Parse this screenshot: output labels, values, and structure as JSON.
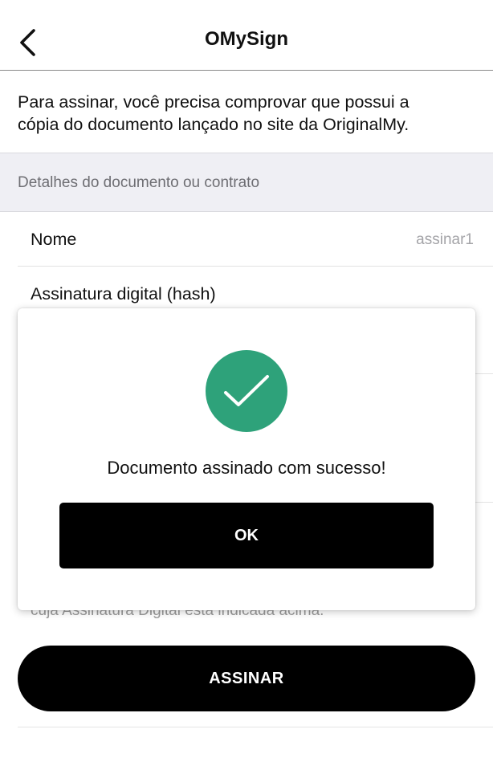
{
  "header": {
    "title": "OMySign",
    "back_icon": "chevron-left-icon"
  },
  "intro": {
    "text_line1": "Para assinar, você precisa comprovar que possui a",
    "text_line2": "cópia do documento lançado no site da OriginalMy."
  },
  "section": {
    "title": "Detalhes do documento ou contrato"
  },
  "details": {
    "name_label": "Nome",
    "name_value": "assinar1",
    "hash_label": "Assinatura digital (hash)"
  },
  "footnote": "cuja Assinatura Digital está indicada acima.",
  "actions": {
    "sign_label": "ASSINAR"
  },
  "modal": {
    "icon": "check-circle-icon",
    "message": "Documento assinado com sucesso!",
    "ok_label": "OK",
    "success_color": "#2ea27a"
  }
}
